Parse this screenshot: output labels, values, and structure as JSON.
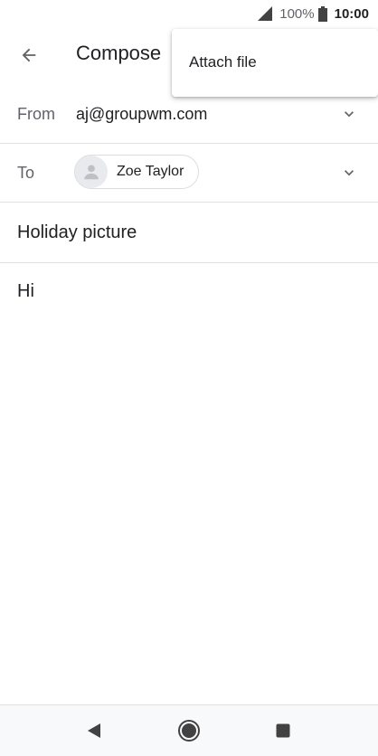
{
  "status_bar": {
    "battery_percent": "100%",
    "time": "10:00"
  },
  "app_bar": {
    "title": "Compose"
  },
  "menu": {
    "items": [
      {
        "label": "Attach file"
      }
    ]
  },
  "from_row": {
    "label": "From",
    "value": "aj@groupwm.com"
  },
  "to_row": {
    "label": "To",
    "recipients": [
      {
        "name": "Zoe Taylor"
      }
    ]
  },
  "subject": "Holiday picture",
  "body": "Hi",
  "colors": {
    "text_primary": "#202124",
    "text_secondary": "#5f6368",
    "divider": "#e0e0e0",
    "nav_icon": "#424242"
  }
}
